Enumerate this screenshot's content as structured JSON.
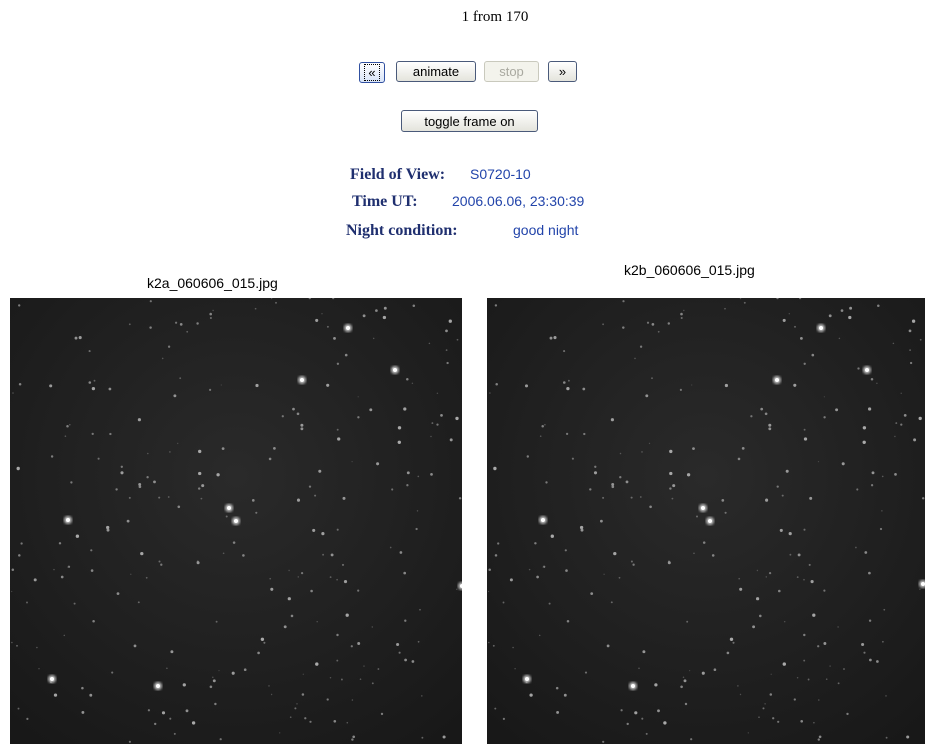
{
  "frame_counter": "1 from 170",
  "controls": {
    "prev_label": "«",
    "animate_label": "animate",
    "stop_label": "stop",
    "next_label": "»",
    "toggle_label": "toggle frame on"
  },
  "info": {
    "fov_label": "Field of View:",
    "fov_value": "S0720-10",
    "time_label": "Time UT:",
    "time_value": "2006.06.06, 23:30:39",
    "night_label": "Night condition:",
    "night_value": "good night"
  },
  "images": {
    "left_title": "k2a_060606_015.jpg",
    "right_title": "k2b_060606_015.jpg"
  },
  "colors": {
    "link_blue": "#2244aa",
    "label_navy": "#1f2f6f",
    "sky_dark": "#1e1e1e"
  }
}
